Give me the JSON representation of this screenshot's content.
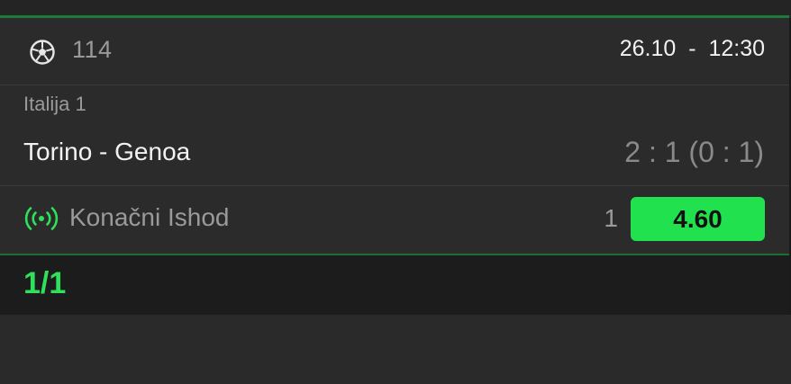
{
  "event": {
    "sport_icon": "soccer-ball-icon",
    "code": "114",
    "date": "26.10",
    "separator": "-",
    "time": "12:30",
    "league": "Italija 1",
    "match": "Torino - Genoa",
    "score": "2 : 1 (0 : 1)"
  },
  "bet": {
    "live_icon": "live-broadcast-icon",
    "market": "Konačni Ishod",
    "pick": "1",
    "odds": "4.60"
  },
  "footer": {
    "counter": "1/1"
  },
  "colors": {
    "background": "#2a2a2a",
    "accent_green": "#22e14f",
    "counter_green": "#2fe05a",
    "divider_green": "#1d7a3c"
  }
}
